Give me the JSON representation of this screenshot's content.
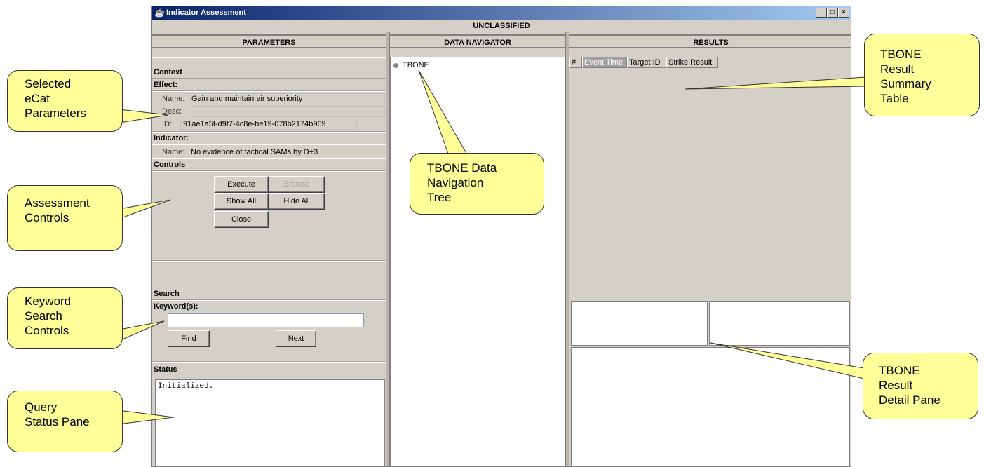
{
  "window": {
    "title": "Indicator Assessment",
    "classification": "UNCLASSIFIED",
    "controls": {
      "minimize": "_",
      "maximize": "□",
      "close": "×"
    }
  },
  "parameters": {
    "header": "PARAMETERS",
    "context_label": "Context",
    "effect_label": "Effect:",
    "effect": {
      "name_label": "Name:",
      "name_value": "Gain and maintain air superiority",
      "desc_label": "Desc:",
      "desc_value": "",
      "id_label": "ID:",
      "id_value": "91ae1a5f-d9f7-4c8e-be19-078b2174b969"
    },
    "indicator_label": "Indicator:",
    "indicator": {
      "name_label": "Name:",
      "name_value": "No evidence of tactical SAMs by D+3"
    },
    "controls_label": "Controls",
    "buttons": {
      "execute": "Execute",
      "browse": "Browse",
      "show_all": "Show All",
      "hide_all": "Hide All",
      "close": "Close"
    },
    "search_label": "Search",
    "keywords_label": "Keyword(s):",
    "keywords_value": "",
    "find": "Find",
    "next": "Next",
    "status_label": "Status",
    "status_text": "Initialized."
  },
  "navigator": {
    "header": "DATA NAVIGATOR",
    "tree": [
      {
        "label": "TBONE"
      }
    ]
  },
  "results": {
    "header": "RESULTS",
    "columns": [
      "#",
      "Event Time",
      "Target ID",
      "Strike Result"
    ],
    "sorted_column": "Event Time",
    "rows": []
  },
  "callouts": {
    "selected_params": "Selected\neCat\nParameters",
    "assessment_controls": "Assessment\nControls",
    "keyword_search": "Keyword\nSearch\nControls",
    "query_status": "Query\nStatus Pane",
    "nav_tree": "TBONE Data\nNavigation\nTree",
    "summary_table": "TBONE\nResult\nSummary\nTable",
    "detail_pane": "TBONE\nResult\nDetail Pane"
  },
  "colors": {
    "window_bg": "#d4d0c8",
    "titlebar_start": "#0a246a",
    "titlebar_end": "#a6caf0",
    "callout_fill": "#ffff99"
  },
  "icons": [
    "java-cup-icon",
    "tree-node-icon",
    "minimize-icon",
    "maximize-icon",
    "close-icon"
  ]
}
